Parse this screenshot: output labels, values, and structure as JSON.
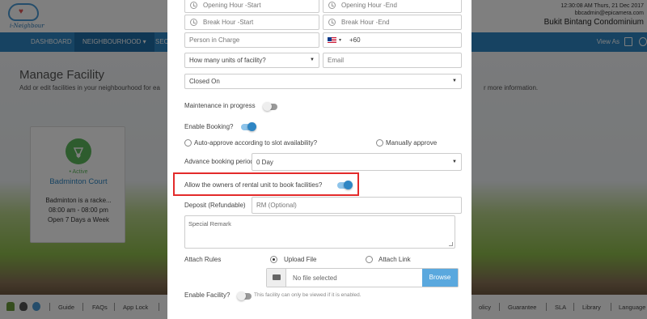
{
  "app": {
    "logo_text": "i-Neighbour",
    "datetime": "12:30:08 AM  Thurs, 21 Dec 2017",
    "user_email": "bbcadmin@epicamera.com",
    "condo_name": "Bukit Bintang Condominium"
  },
  "nav": {
    "items": [
      "DASHBOARD",
      "NEIGHBOURHOOD ▾",
      "SEC"
    ],
    "view_as": "View As"
  },
  "page": {
    "title": "Manage Facility",
    "subtitle": "Add or edit facilities in your neighbourhood for ea",
    "subtitle_right": "r more information."
  },
  "facility_card": {
    "status": "• Active",
    "name": "Badminton Court",
    "lines": [
      "Badminton is a racke...",
      "08:00 am - 08:00 pm",
      "Open 7 Days a Week"
    ]
  },
  "footer": {
    "links_left": [
      "Guide",
      "FAQs",
      "App Lock"
    ],
    "links_right": [
      "olicy",
      "Guarantee",
      "SLA",
      "Library",
      "Language"
    ]
  },
  "form": {
    "opening_start": "Opening Hour -Start",
    "opening_end": "Opening Hour -End",
    "break_start": "Break Hour -Start",
    "break_end": "Break Hour -End",
    "person_in_charge": "Person in Charge",
    "phone_code": "+60",
    "units_placeholder": "How many units of facility?",
    "email_placeholder": "Email",
    "closed_on": "Closed On",
    "maintenance_label": "Maintenance in progress",
    "maintenance_on": false,
    "enable_booking_label": "Enable Booking?",
    "enable_booking_on": true,
    "auto_approve_label": "Auto-approve according to slot availability?",
    "manual_approve_label": "Manually approve",
    "advance_label": "Advance booking period",
    "advance_value": "0 Day",
    "rental_label": "Allow the owners of rental unit to book facilities?",
    "rental_on": true,
    "deposit_label": "Deposit (Refundable)",
    "deposit_placeholder": "RM (Optional)",
    "special_remark_placeholder": "Special Remark",
    "attach_rules_label": "Attach Rules",
    "upload_file_label": "Upload File",
    "attach_link_label": "Attach Link",
    "rules_mode": "upload",
    "file_placeholder": "No file selected",
    "browse_label": "Browse",
    "enable_facility_label": "Enable Facility?",
    "enable_facility_on": false,
    "enable_facility_note": "This facility can only be viewed if it is enabled."
  },
  "colors": {
    "accent": "#2f86c4",
    "highlight": "#e32b2b",
    "active": "#5cb85c"
  }
}
